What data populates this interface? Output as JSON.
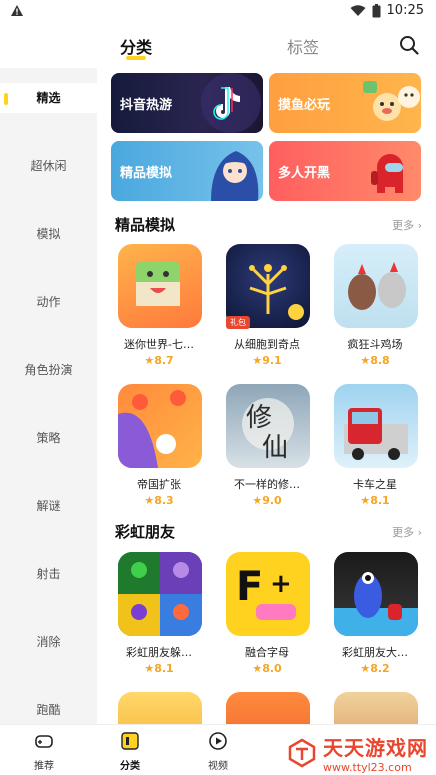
{
  "status": {
    "time": "10:25"
  },
  "header": {
    "tabs": [
      "分类",
      "标签"
    ]
  },
  "sidebar": {
    "items": [
      "精选",
      "超休闲",
      "模拟",
      "动作",
      "角色扮演",
      "策略",
      "解谜",
      "射击",
      "消除",
      "跑酷"
    ]
  },
  "banners": [
    "抖音热游",
    "摸鱼必玩",
    "精品模拟",
    "多人开黑"
  ],
  "sections": [
    {
      "title": "精品模拟",
      "more": "更多",
      "apps": [
        {
          "name": "迷你世界-七…",
          "rating": "8.7",
          "badge": ""
        },
        {
          "name": "从细胞到奇点",
          "rating": "9.1",
          "badge": "礼包"
        },
        {
          "name": "疯狂斗鸡场",
          "rating": "8.8",
          "badge": ""
        },
        {
          "name": "帝国扩张",
          "rating": "8.3",
          "badge": ""
        },
        {
          "name": "不一样的修…",
          "rating": "9.0",
          "badge": ""
        },
        {
          "name": "卡车之星",
          "rating": "8.1",
          "badge": ""
        }
      ]
    },
    {
      "title": "彩虹朋友",
      "more": "更多",
      "apps": [
        {
          "name": "彩虹朋友躲…",
          "rating": "8.1",
          "badge": ""
        },
        {
          "name": "融合字母",
          "rating": "8.0",
          "badge": ""
        },
        {
          "name": "彩虹朋友大…",
          "rating": "8.2",
          "badge": ""
        }
      ]
    }
  ],
  "bottom_nav": [
    "推荐",
    "分类",
    "视频"
  ],
  "watermark": {
    "text": "天天游戏网",
    "url": "www.ttyl23.com"
  },
  "colors": {
    "accent": "#ffd21f",
    "rating": "#f5a623",
    "sidebar_bg": "#f4f4f4"
  }
}
